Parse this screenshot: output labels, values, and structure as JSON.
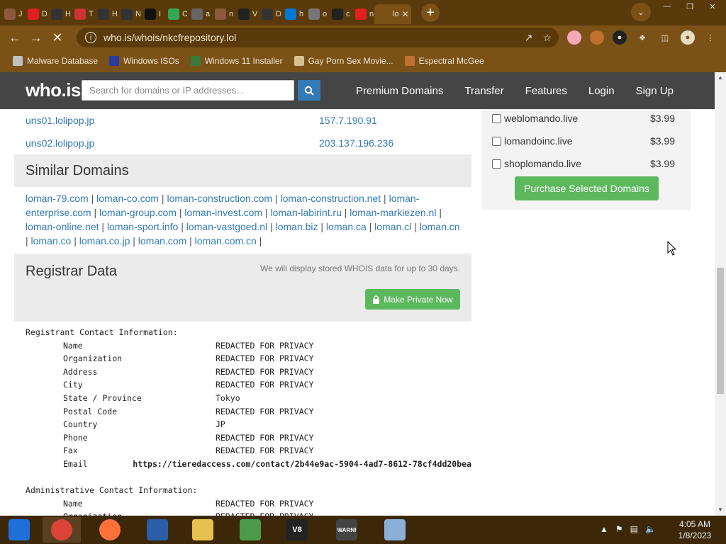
{
  "browser": {
    "tabs": [
      {
        "label": "J",
        "icon": "avatar-icon",
        "color": "#8a5a3a"
      },
      {
        "label": "D",
        "icon": "youtube-icon",
        "color": "#e02020"
      },
      {
        "label": "H",
        "icon": "glasses-icon",
        "color": "#333333"
      },
      {
        "label": "T",
        "icon": "image-icon",
        "color": "#cc3333"
      },
      {
        "label": "H",
        "icon": "glasses-icon",
        "color": "#333333"
      },
      {
        "label": "N",
        "icon": "glasses-icon",
        "color": "#333333"
      },
      {
        "label": "I",
        "icon": "ip-icon",
        "color": "#111111"
      },
      {
        "label": "C",
        "icon": "maps-icon",
        "color": "#34a853"
      },
      {
        "label": "a",
        "icon": "globe-icon",
        "color": "#666666"
      },
      {
        "label": "n",
        "icon": "avatar-icon",
        "color": "#8a5a3a"
      },
      {
        "label": "V",
        "icon": "building-icon",
        "color": "#222222"
      },
      {
        "label": "D",
        "icon": "v8-icon",
        "color": "#333333"
      },
      {
        "label": "h",
        "icon": "windows-icon",
        "color": "#0078d7"
      },
      {
        "label": "o",
        "icon": "gray-circle-icon",
        "color": "#777777"
      },
      {
        "label": "c",
        "icon": "w-icon",
        "color": "#222222"
      },
      {
        "label": "n",
        "icon": "youtube-icon",
        "color": "#e02020"
      },
      {
        "label": "lo",
        "icon": "page-icon",
        "color": "#7a5218"
      }
    ],
    "url": "who.is/whois/nkcfrepository.lol",
    "bookmarks": [
      {
        "label": "Malware Database",
        "icon": "folder-icon"
      },
      {
        "label": "Windows ISOs",
        "icon": "x-icon"
      },
      {
        "label": "Windows 11 Installer",
        "icon": "image-icon"
      },
      {
        "label": "Gay Porn Sex Movie...",
        "icon": "box-icon"
      },
      {
        "label": "Espectral McGee",
        "icon": "avatar-icon"
      }
    ]
  },
  "site": {
    "logo": "who.is",
    "search_placeholder": "Search for domains or IP addresses...",
    "nav": [
      "Premium Domains",
      "Transfer",
      "Features",
      "Login",
      "Sign Up"
    ],
    "nameservers": [
      {
        "host": "uns01.lolipop.jp",
        "ip": "157.7.190.91"
      },
      {
        "host": "uns02.lolipop.jp",
        "ip": "203.137.196.236"
      }
    ],
    "similar_title": "Similar Domains",
    "similar": [
      "loman-79.com",
      "loman-co.com",
      "loman-construction.com",
      "loman-construction.net",
      "loman-enterprise.com",
      "loman-group.com",
      "loman-invest.com",
      "loman-labirint.ru",
      "loman-markiezen.nl",
      "loman-online.net",
      "loman-sport.info",
      "loman-vastgoed.nl",
      "loman.biz",
      "loman.ca",
      "loman.cl",
      "loman.cn",
      "loman.co",
      "loman.co.jp",
      "loman.com",
      "loman.com.cn"
    ],
    "registrar_title": "Registrar Data",
    "registrar_note": "We will display stored WHOIS data for up to 30 days.",
    "make_private": "Make Private Now",
    "registrant_heading": "Registrant Contact Information:",
    "registrant": [
      {
        "k": "Name",
        "v": "REDACTED FOR PRIVACY"
      },
      {
        "k": "Organization",
        "v": "REDACTED FOR PRIVACY"
      },
      {
        "k": "Address",
        "v": "REDACTED FOR PRIVACY"
      },
      {
        "k": "City",
        "v": "REDACTED FOR PRIVACY"
      },
      {
        "k": "State / Province",
        "v": "Tokyo"
      },
      {
        "k": "Postal Code",
        "v": "REDACTED FOR PRIVACY"
      },
      {
        "k": "Country",
        "v": "JP"
      },
      {
        "k": "Phone",
        "v": "REDACTED FOR PRIVACY"
      },
      {
        "k": "Fax",
        "v": "REDACTED FOR PRIVACY"
      },
      {
        "k": "Email",
        "v": "https://tieredaccess.com/contact/2b44e9ac-5904-4ad7-8612-78cf4dd20bea"
      }
    ],
    "admin_heading": "Administrative Contact Information:",
    "admin": [
      {
        "k": "Name",
        "v": "REDACTED FOR PRIVACY"
      },
      {
        "k": "Organization",
        "v": "REDACTED FOR PRIVACY"
      }
    ],
    "suggestions": [
      {
        "domain": "weblomando.live",
        "price": "$3.99"
      },
      {
        "domain": "lomandoinc.live",
        "price": "$3.99"
      },
      {
        "domain": "shoplomando.live",
        "price": "$3.99"
      }
    ],
    "purchase_label": "Purchase Selected Domains"
  },
  "taskbar": {
    "apps": [
      {
        "name": "start-button",
        "label": "",
        "color": "#1e6fd9"
      },
      {
        "name": "chrome-app",
        "label": "",
        "color": "#db4437"
      },
      {
        "name": "firefox-app",
        "label": "",
        "color": "#ff7139"
      },
      {
        "name": "obama-logo-app",
        "label": "",
        "color": "#2a5ea8"
      },
      {
        "name": "file-explorer-app",
        "label": "",
        "color": "#e8c050"
      },
      {
        "name": "network-app",
        "label": "",
        "color": "#4a9a4a"
      },
      {
        "name": "v8-app",
        "label": "V8",
        "color": "#222222"
      },
      {
        "name": "warning-app",
        "label": "WARNI",
        "color": "#444444"
      },
      {
        "name": "disc-app",
        "label": "",
        "color": "#8ab0d8"
      }
    ],
    "time": "4:05 AM",
    "date": "1/8/2023",
    "colors": {
      "taskbar_bg": "#3c2808",
      "tab_bg": "#5a3a0a",
      "toolbar_bg": "#7a5218",
      "link": "#337ab7",
      "green": "#5cb85c"
    }
  }
}
